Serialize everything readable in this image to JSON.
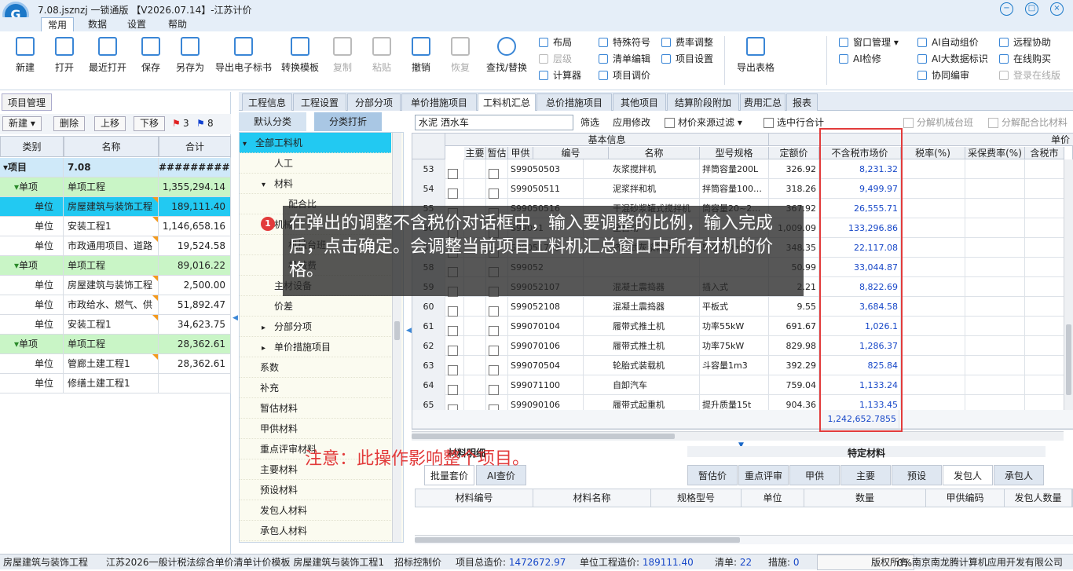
{
  "window": {
    "title": "7.08.jsznzj  一锁通版  【V2026.07.14】-江苏计价",
    "logo_glyph": "G"
  },
  "menu": [
    "常用",
    "数据",
    "设置",
    "帮助"
  ],
  "ribbon": {
    "large": [
      {
        "label": "新建",
        "icon": "new-file-icon"
      },
      {
        "label": "打开",
        "icon": "open-folder-icon"
      },
      {
        "label": "最近打开",
        "icon": "recent-icon"
      },
      {
        "label": "保存",
        "icon": "save-icon"
      },
      {
        "label": "另存为",
        "icon": "save-as-icon"
      },
      {
        "label": "导出电子标书",
        "icon": "export-bid-icon"
      },
      {
        "label": "转换模板",
        "icon": "convert-template-icon"
      },
      {
        "label": "复制",
        "icon": "copy-icon",
        "disabled": true
      },
      {
        "label": "粘贴",
        "icon": "paste-icon",
        "disabled": true
      },
      {
        "label": "撤销",
        "icon": "undo-icon"
      },
      {
        "label": "恢复",
        "icon": "redo-icon",
        "disabled": true
      },
      {
        "label": "查找/替换",
        "icon": "search-icon"
      },
      {
        "label": "导出表格",
        "icon": "export-excel-icon"
      }
    ],
    "small": [
      {
        "label": "布局",
        "icon": "layout-icon"
      },
      {
        "label": "层级",
        "icon": "level-icon",
        "disabled": true
      },
      {
        "label": "计算器",
        "icon": "calculator-icon"
      },
      {
        "label": "特殊符号",
        "icon": "omega-icon"
      },
      {
        "label": "清单编辑",
        "icon": "lock-icon"
      },
      {
        "label": "项目调价",
        "icon": "price-adjust-icon"
      },
      {
        "label": "费率调整",
        "icon": "rate-icon"
      },
      {
        "label": "项目设置",
        "icon": "settings-icon"
      },
      {
        "label": "窗口管理",
        "icon": "window-icon"
      },
      {
        "label": "AI检修",
        "icon": "ai-check-icon"
      },
      {
        "label": "AI自动组价",
        "icon": "ai-price-icon"
      },
      {
        "label": "AI大数据标识",
        "icon": "ai-data-icon"
      },
      {
        "label": "协同编审",
        "icon": "collab-icon"
      },
      {
        "label": "远程协助",
        "icon": "remote-icon"
      },
      {
        "label": "在线购买",
        "icon": "buy-icon"
      },
      {
        "label": "登录在线版",
        "icon": "login-icon",
        "disabled": true
      }
    ]
  },
  "left_panel": {
    "tab": "项目管理",
    "buttons": [
      "新建",
      "删除",
      "上移",
      "下移"
    ],
    "flag_red_count": "3",
    "flag_blue_count": "8",
    "headers": [
      "类别",
      "名称",
      "合计"
    ],
    "rows": [
      {
        "type": "项目",
        "name": "7.08",
        "total": "###########",
        "style": "item0"
      },
      {
        "type": "单项",
        "name": "单项工程",
        "total": "1,355,294.14",
        "style": "green"
      },
      {
        "type": "单位",
        "name": "房屋建筑与装饰工程",
        "total": "189,111.40",
        "style": "cyan"
      },
      {
        "type": "单位",
        "name": "安装工程1",
        "total": "1,146,658.16",
        "style": ""
      },
      {
        "type": "单位",
        "name": "市政通用项目、道路",
        "total": "19,524.58",
        "style": ""
      },
      {
        "type": "单项",
        "name": "单项工程",
        "total": "89,016.22",
        "style": "green"
      },
      {
        "type": "单位",
        "name": "房屋建筑与装饰工程",
        "total": "2,500.00",
        "style": ""
      },
      {
        "type": "单位",
        "name": "市政给水、燃气、供",
        "total": "51,892.47",
        "style": ""
      },
      {
        "type": "单位",
        "name": "安装工程1",
        "total": "34,623.75",
        "style": ""
      },
      {
        "type": "单项",
        "name": "单项工程",
        "total": "28,362.61",
        "style": "green"
      },
      {
        "type": "单位",
        "name": "管廊土建工程1",
        "total": "28,362.61",
        "style": ""
      },
      {
        "type": "单位",
        "name": "修缮土建工程1",
        "total": "",
        "style": ""
      }
    ]
  },
  "main_tabs": [
    "工程信息",
    "工程设置",
    "分部分项",
    "单价措施项目",
    "工料机汇总",
    "总价措施项目",
    "其他项目",
    "结算阶段附加",
    "费用汇总",
    "报表"
  ],
  "mid_tabs": [
    "默认分类",
    "分类打折"
  ],
  "tree": [
    {
      "label": "全部工料机",
      "indent": 0,
      "sel": true,
      "expand": "▾"
    },
    {
      "label": "人工",
      "indent": 2
    },
    {
      "label": "材料",
      "indent": 2,
      "expand": "▾"
    },
    {
      "label": "配合比",
      "indent": 3
    },
    {
      "label": "机械",
      "indent": 2
    },
    {
      "label": "机械台班",
      "indent": 3
    },
    {
      "label": "机械费",
      "indent": 3
    },
    {
      "label": "主材设备",
      "indent": 2
    },
    {
      "label": "价差",
      "indent": 2
    },
    {
      "label": "分部分项",
      "indent": 2,
      "expand": "▸"
    },
    {
      "label": "单价措施项目",
      "indent": 2,
      "expand": "▸"
    },
    {
      "label": "系数",
      "indent": 1
    },
    {
      "label": "补充",
      "indent": 1
    },
    {
      "label": "暂估材料",
      "indent": 1
    },
    {
      "label": "甲供材料",
      "indent": 1
    },
    {
      "label": "重点评审材料",
      "indent": 1
    },
    {
      "label": "主要材料",
      "indent": 1
    },
    {
      "label": "预设材料",
      "indent": 1
    },
    {
      "label": "发包人材料",
      "indent": 1
    },
    {
      "label": "承包人材料",
      "indent": 1
    }
  ],
  "filter": {
    "value": "水泥 洒水车",
    "filter_btn": "筛选",
    "apply_btn": "应用修改",
    "source_filter": "材价来源过滤",
    "select_row": "选中行合计",
    "decompose_machine": "分解机械台班",
    "decompose_mix": "分解配合比材料"
  },
  "grid": {
    "group_basic": "基本信息",
    "group_unit": "单价",
    "headers": [
      "主要",
      "暂估",
      "甲供",
      "编号",
      "名称",
      "型号规格",
      "定额价",
      "不含税市场价",
      "税率(%)",
      "采保费率(%)",
      "含税市"
    ],
    "rows": [
      {
        "n": "53",
        "code": "S99050503",
        "name": "灰浆搅拌机",
        "spec": "拌筒容量200L",
        "quota": "326.92",
        "market": "8,231.32"
      },
      {
        "n": "54",
        "code": "S99050511",
        "name": "泥浆拌和机",
        "spec": "拌筒容量100…",
        "quota": "318.26",
        "market": "9,499.97"
      },
      {
        "n": "55",
        "code": "S99050516",
        "name": "干混砂浆罐式搅拌机",
        "spec": "筒容量20~2…",
        "quota": "367.92",
        "market": "26,555.71"
      },
      {
        "n": "56",
        "code": "S99051",
        "name": "全自动",
        "spec": "",
        "quota": "1,009.09",
        "market": "133,296.86"
      },
      {
        "n": "57",
        "code": "S99051703",
        "name": "挤压式灰浆输送泵",
        "spec": "输送量3m3/h",
        "quota": "348.35",
        "market": "22,117.08"
      },
      {
        "n": "58",
        "code": "S99052",
        "name": "",
        "spec": "",
        "quota": "50.99",
        "market": "33,044.87"
      },
      {
        "n": "59",
        "code": "S99052107",
        "name": "混凝土震捣器",
        "spec": "插入式",
        "quota": "2.21",
        "market": "8,822.69"
      },
      {
        "n": "60",
        "code": "S99052108",
        "name": "混凝土震捣器",
        "spec": "平板式",
        "quota": "9.55",
        "market": "3,684.58"
      },
      {
        "n": "61",
        "code": "S99070104",
        "name": "履带式推土机",
        "spec": "功率55kW",
        "quota": "691.67",
        "market": "1,026.1"
      },
      {
        "n": "62",
        "code": "S99070106",
        "name": "履带式推土机",
        "spec": "功率75kW",
        "quota": "829.98",
        "market": "1,286.37"
      },
      {
        "n": "63",
        "code": "S99070504",
        "name": "轮胎式装载机",
        "spec": "斗容量1m3",
        "quota": "392.29",
        "market": "825.84"
      },
      {
        "n": "64",
        "code": "S99071100",
        "name": "自卸汽车",
        "spec": "",
        "quota": "759.04",
        "market": "1,133.24"
      },
      {
        "n": "65",
        "code": "S99090106",
        "name": "履带式起重机",
        "spec": "提升质量15t",
        "quota": "904.36",
        "market": "1,133.45"
      }
    ],
    "total_market": "1,242,652.7855"
  },
  "bottom": {
    "left_title": "材料明细",
    "left_tabs": [
      "批量套价",
      "AI查价"
    ],
    "spec_title": "特定材料",
    "spec_tabs": [
      "暂估价",
      "重点评审",
      "甲供",
      "主要",
      "预设",
      "发包人",
      "承包人"
    ],
    "headers": [
      "材料编号",
      "材料名称",
      "规格型号",
      "单位",
      "数量",
      "甲供编码",
      "发包人数量"
    ]
  },
  "status": {
    "unit": "房屋建筑与装饰工程",
    "template": "江苏2026一般计税法综合单价清单计价模板 房屋建筑与装饰工程1",
    "control": "招标控制价",
    "project_total_label": "项目总造价:",
    "project_total": "1472672.97",
    "unit_total_label": "单位工程造价:",
    "unit_total": "189111.40",
    "list_label": "清单:",
    "list_count": "22",
    "measure_label": "措施:",
    "measure_count": "0",
    "progress": "0%",
    "copyright": "版权所有 南京南龙腾计算机应用开发有限公司"
  },
  "overlay": {
    "badge": "1",
    "tip": "在弹出的调整不含税价对话框中，输入要调整的比例，输入完成后，点击确定。会调整当前项目工料机汇总窗口中所有材机的价格。",
    "note": "注意：此操作影响整个项目。"
  }
}
